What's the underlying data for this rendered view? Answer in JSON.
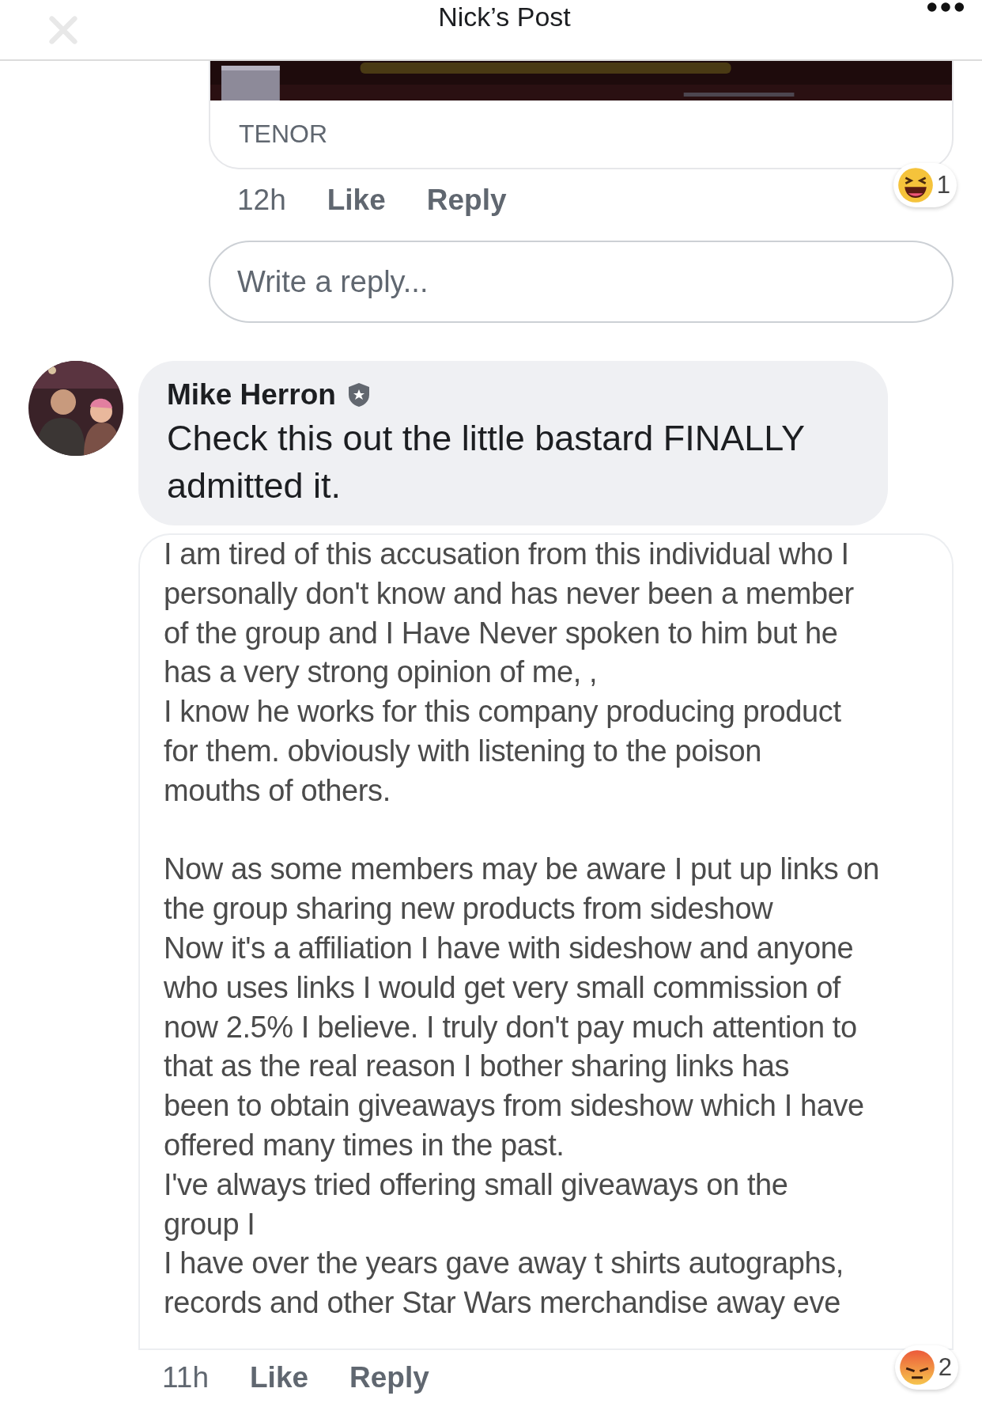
{
  "header": {
    "title": "Nick’s Post"
  },
  "gif_comment": {
    "media": {
      "kind": "picture",
      "source": "TENOR"
    },
    "time": "12h",
    "actions": [
      "Like",
      "Reply"
    ],
    "reaction": {
      "kind": "haha",
      "count": "1"
    }
  },
  "reply_field": {
    "placeholder": "Write a reply..."
  },
  "comment": {
    "author": "Mike Herron",
    "text": "Check this out the little bastard FINALLY admitted it.",
    "time": "11h",
    "actions": [
      "Like",
      "Reply"
    ],
    "reaction": {
      "kind": "angry",
      "count": "2"
    },
    "screenshot_paragraphs": [
      {
        "lines": [
          "I am tired of this accusation from this individual who I",
          "personally don't know and has never been a member",
          "of the group and I Have Never spoken to him but he",
          "has a very strong opinion of me, ,",
          "I know he works for this company producing product",
          "for them. obviously with listening to the poison",
          "mouths of others."
        ]
      },
      {
        "lines": [
          "Now as some members may be aware I put up links on",
          "the group sharing new products from sideshow",
          "Now it's a affiliation I have with sideshow and anyone",
          "who uses links I would get very small commission of",
          "now 2.5% I believe. I truly don't pay much attention to",
          "that as the real reason I bother  sharing links  has",
          "been to obtain giveaways from sideshow which I have",
          "offered many times in the past.",
          "I've always tried  offering small giveaways on the",
          "group I",
          "I have over the years gave away t shirts autographs,",
          "records and other Star Wars merchandise away eve"
        ]
      }
    ]
  }
}
